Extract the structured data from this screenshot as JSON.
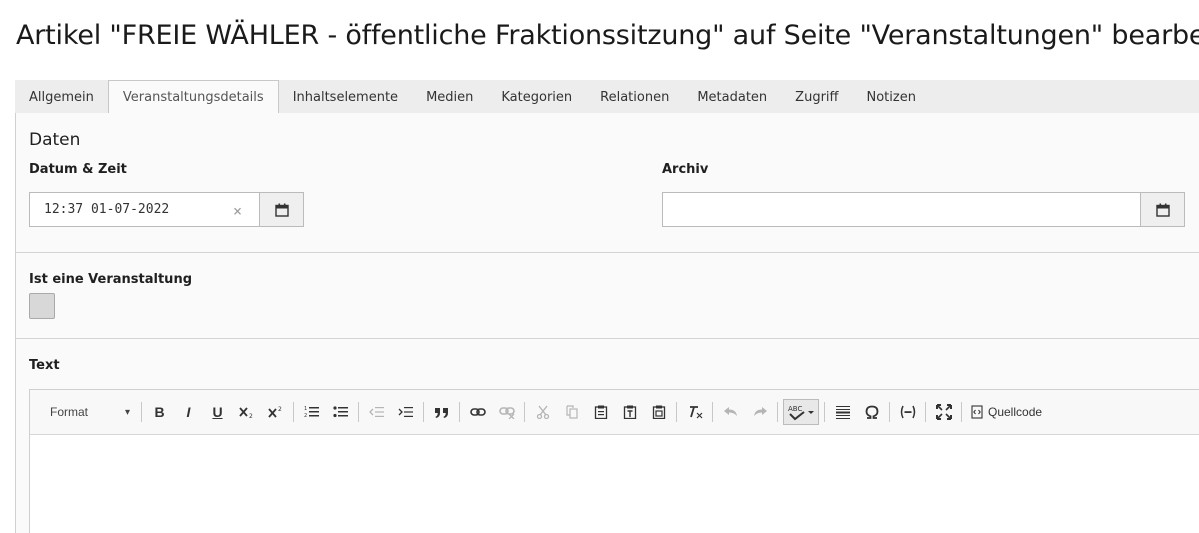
{
  "page_title": "Artikel \"FREIE WÄHLER - öffentliche Fraktionssitzung\" auf Seite \"Veranstaltungen\" bearbeiten",
  "tabs": [
    {
      "label": "Allgemein",
      "active": false
    },
    {
      "label": "Veranstaltungsdetails",
      "active": true
    },
    {
      "label": "Inhaltselemente",
      "active": false
    },
    {
      "label": "Medien",
      "active": false
    },
    {
      "label": "Kategorien",
      "active": false
    },
    {
      "label": "Relationen",
      "active": false
    },
    {
      "label": "Metadaten",
      "active": false
    },
    {
      "label": "Zugriff",
      "active": false
    },
    {
      "label": "Notizen",
      "active": false
    }
  ],
  "section": {
    "title": "Daten"
  },
  "datetime": {
    "label": "Datum & Zeit",
    "value": "12:37 01-07-2022",
    "clear_glyph": "×"
  },
  "archive": {
    "label": "Archiv",
    "value": ""
  },
  "is_event": {
    "label": "Ist eine Veranstaltung",
    "checked": false
  },
  "text": {
    "label": "Text",
    "toolbar": {
      "format_label": "Format",
      "format_caret": "▾",
      "bold": "B",
      "italic": "I",
      "underline": "U",
      "source_label": "Quellcode"
    }
  }
}
